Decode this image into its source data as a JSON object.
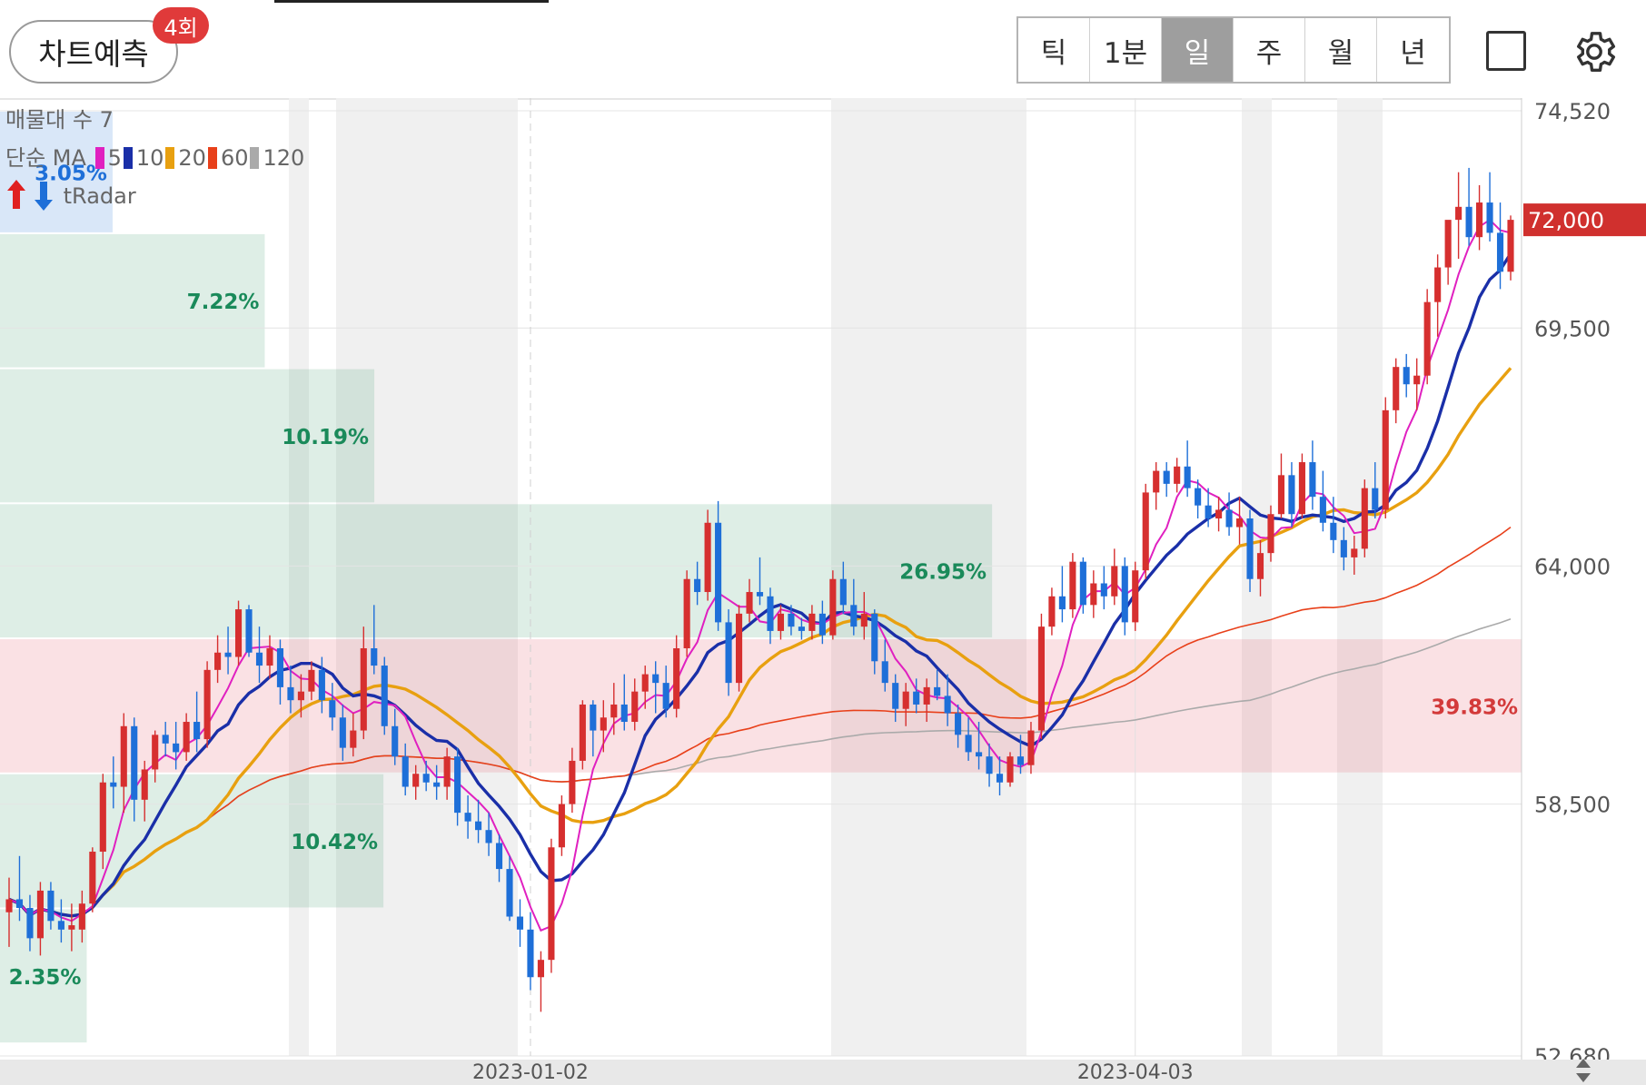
{
  "header": {
    "predict_label": "차트예측",
    "predict_badge": "4회",
    "periods": [
      "틱",
      "1분",
      "일",
      "주",
      "월",
      "년"
    ],
    "active_period": "일"
  },
  "legend": {
    "volume_profile": "매물대 수 7",
    "ma_prefix": "단순 MA",
    "ma": [
      {
        "label": "5",
        "color": "#e020c0"
      },
      {
        "label": "10",
        "color": "#1a2fa8"
      },
      {
        "label": "20",
        "color": "#e8a010"
      },
      {
        "label": "60",
        "color": "#e8401a"
      },
      {
        "label": "120",
        "color": "#aaaaaa"
      }
    ],
    "tradar": "tRadar"
  },
  "chart_data": {
    "type": "candlestick",
    "ylim": [
      52680,
      74520
    ],
    "y_ticks": [
      "74,520",
      "69,500",
      "64,000",
      "58,500",
      "52,680"
    ],
    "y_tick_values": [
      74520,
      69500,
      64000,
      58500,
      52680
    ],
    "current_price": "72,000",
    "current_price_value": 72000,
    "x_ticks": [
      "2023-01-02",
      "2023-04-03"
    ],
    "up_color": "#d62f2f",
    "down_color": "#1e6fd8",
    "volume_profile": [
      {
        "low": 71690,
        "high": 74520,
        "pct": "3.05%",
        "width": 0.074
      },
      {
        "low": 68570,
        "high": 71690,
        "pct": "7.22%",
        "width": 0.174
      },
      {
        "low": 65450,
        "high": 68570,
        "pct": "10.19%",
        "width": 0.246
      },
      {
        "low": 62330,
        "high": 65450,
        "pct": "26.95%",
        "width": 0.652
      },
      {
        "low": 59210,
        "high": 62330,
        "pct": "39.83%",
        "width": 1.0
      },
      {
        "low": 56090,
        "high": 59210,
        "pct": "10.42%",
        "width": 0.252
      },
      {
        "low": 52970,
        "high": 56090,
        "pct": "2.35%",
        "width": 0.057
      }
    ],
    "candles": [
      [
        56000,
        56800,
        55200,
        56300
      ],
      [
        56300,
        57300,
        55800,
        56100
      ],
      [
        56100,
        56400,
        55100,
        55400
      ],
      [
        55400,
        56700,
        55000,
        56500
      ],
      [
        56500,
        56700,
        55600,
        55800
      ],
      [
        55800,
        56300,
        55300,
        55600
      ],
      [
        55600,
        56200,
        55100,
        55700
      ],
      [
        55600,
        56500,
        55300,
        56200
      ],
      [
        56200,
        57500,
        56000,
        57400
      ],
      [
        57400,
        59200,
        57000,
        59000
      ],
      [
        59000,
        59600,
        58400,
        58900
      ],
      [
        58900,
        60600,
        58300,
        60300
      ],
      [
        60300,
        60500,
        58100,
        58600
      ],
      [
        58600,
        59500,
        58100,
        59300
      ],
      [
        59300,
        60200,
        59000,
        60100
      ],
      [
        60100,
        60400,
        59600,
        59900
      ],
      [
        59900,
        60400,
        59300,
        59700
      ],
      [
        59700,
        60600,
        59500,
        60400
      ],
      [
        60400,
        61100,
        59700,
        60000
      ],
      [
        60000,
        61800,
        59800,
        61600
      ],
      [
        61600,
        62400,
        61300,
        62000
      ],
      [
        62000,
        62600,
        61500,
        61900
      ],
      [
        61900,
        63200,
        61700,
        63000
      ],
      [
        63000,
        63100,
        61900,
        62000
      ],
      [
        62000,
        62600,
        61300,
        61700
      ],
      [
        61700,
        62400,
        61400,
        62100
      ],
      [
        62100,
        62300,
        60800,
        61200
      ],
      [
        61200,
        61700,
        60600,
        60900
      ],
      [
        60900,
        61500,
        60500,
        61100
      ],
      [
        61100,
        61800,
        60900,
        61600
      ],
      [
        61600,
        61900,
        60600,
        60900
      ],
      [
        60900,
        61300,
        60200,
        60500
      ],
      [
        60500,
        60800,
        59500,
        59800
      ],
      [
        59800,
        60600,
        59600,
        60200
      ],
      [
        60200,
        62600,
        60000,
        62100
      ],
      [
        62100,
        63100,
        61500,
        61700
      ],
      [
        61700,
        61900,
        60100,
        60300
      ],
      [
        60300,
        60700,
        59400,
        59600
      ],
      [
        59600,
        59900,
        58700,
        58900
      ],
      [
        58900,
        59400,
        58600,
        59200
      ],
      [
        59200,
        59500,
        58800,
        59000
      ],
      [
        59000,
        59400,
        58600,
        58900
      ],
      [
        58900,
        59800,
        58600,
        59600
      ],
      [
        59600,
        59800,
        58000,
        58300
      ],
      [
        58300,
        58700,
        57700,
        58100
      ],
      [
        58100,
        58600,
        57600,
        57900
      ],
      [
        57900,
        58300,
        57300,
        57600
      ],
      [
        57600,
        57800,
        56700,
        57000
      ],
      [
        57000,
        57300,
        55800,
        55900
      ],
      [
        55900,
        56300,
        55200,
        55600
      ],
      [
        55600,
        56000,
        54200,
        54500
      ],
      [
        54500,
        55100,
        53700,
        54900
      ],
      [
        54900,
        57700,
        54600,
        57500
      ],
      [
        57500,
        58700,
        57300,
        58500
      ],
      [
        58500,
        59800,
        58300,
        59500
      ],
      [
        59500,
        60900,
        59300,
        60800
      ],
      [
        60800,
        60900,
        59600,
        60200
      ],
      [
        60200,
        60900,
        59700,
        60500
      ],
      [
        60500,
        61300,
        60100,
        60800
      ],
      [
        60800,
        61500,
        60200,
        60400
      ],
      [
        60400,
        61400,
        60200,
        61100
      ],
      [
        61100,
        61700,
        60700,
        61500
      ],
      [
        61500,
        61800,
        60600,
        61300
      ],
      [
        61300,
        61700,
        60500,
        60700
      ],
      [
        60700,
        62400,
        60500,
        62100
      ],
      [
        62100,
        63900,
        61900,
        63700
      ],
      [
        63700,
        64100,
        63100,
        63400
      ],
      [
        63400,
        65300,
        63200,
        65000
      ],
      [
        65000,
        65500,
        62500,
        62700
      ],
      [
        62700,
        63000,
        61000,
        61300
      ],
      [
        61300,
        63100,
        61100,
        62900
      ],
      [
        62900,
        63700,
        62700,
        63400
      ],
      [
        63400,
        64200,
        63100,
        63300
      ],
      [
        63300,
        63500,
        62200,
        62500
      ],
      [
        62500,
        63100,
        62300,
        62900
      ],
      [
        62900,
        63100,
        62400,
        62600
      ],
      [
        62600,
        62800,
        62300,
        62500
      ],
      [
        62500,
        63100,
        62300,
        62900
      ],
      [
        62900,
        63200,
        62200,
        62400
      ],
      [
        62400,
        63900,
        62300,
        63700
      ],
      [
        63700,
        64100,
        62900,
        63100
      ],
      [
        63100,
        63700,
        62400,
        62600
      ],
      [
        62600,
        63400,
        62300,
        62900
      ],
      [
        62900,
        63000,
        61500,
        61800
      ],
      [
        61800,
        62300,
        61100,
        61300
      ],
      [
        61300,
        61500,
        60400,
        60700
      ],
      [
        60700,
        61300,
        60300,
        61100
      ],
      [
        61100,
        61400,
        60600,
        60800
      ],
      [
        60800,
        61400,
        60400,
        61200
      ],
      [
        61200,
        61600,
        60900,
        61000
      ],
      [
        61000,
        61500,
        60300,
        60600
      ],
      [
        60600,
        60800,
        59800,
        60100
      ],
      [
        60100,
        60500,
        59500,
        59700
      ],
      [
        59700,
        60400,
        59300,
        59600
      ],
      [
        59600,
        59900,
        58900,
        59200
      ],
      [
        59200,
        59600,
        58700,
        59000
      ],
      [
        59000,
        59700,
        58900,
        59600
      ],
      [
        59600,
        60100,
        59200,
        59400
      ],
      [
        59400,
        60400,
        59200,
        60200
      ],
      [
        60200,
        62900,
        60000,
        62600
      ],
      [
        62600,
        63500,
        62400,
        63300
      ],
      [
        63300,
        64000,
        62700,
        63000
      ],
      [
        63000,
        64300,
        62800,
        64100
      ],
      [
        64100,
        64200,
        62900,
        63100
      ],
      [
        63100,
        63900,
        62800,
        63600
      ],
      [
        63600,
        64000,
        63000,
        63300
      ],
      [
        63300,
        64400,
        63100,
        64000
      ],
      [
        64000,
        64200,
        62400,
        62700
      ],
      [
        62700,
        64100,
        62500,
        63900
      ],
      [
        63900,
        65900,
        63700,
        65700
      ],
      [
        65700,
        66400,
        65300,
        66200
      ],
      [
        66200,
        66400,
        65600,
        65900
      ],
      [
        65900,
        66500,
        65700,
        66300
      ],
      [
        66300,
        66900,
        65600,
        65800
      ],
      [
        65800,
        66000,
        65100,
        65400
      ],
      [
        65400,
        65800,
        64900,
        65100
      ],
      [
        65100,
        65600,
        64800,
        65300
      ],
      [
        65300,
        65700,
        64700,
        64900
      ],
      [
        64900,
        65600,
        64500,
        65100
      ],
      [
        65100,
        65300,
        63400,
        63700
      ],
      [
        63700,
        64600,
        63300,
        64300
      ],
      [
        64300,
        65400,
        64100,
        65200
      ],
      [
        65200,
        66600,
        65100,
        66100
      ],
      [
        66100,
        66400,
        64900,
        65200
      ],
      [
        65200,
        66600,
        65100,
        66400
      ],
      [
        66400,
        66900,
        65300,
        65600
      ],
      [
        65600,
        66200,
        64800,
        65000
      ],
      [
        65000,
        65600,
        64300,
        64600
      ],
      [
        64600,
        64900,
        63900,
        64200
      ],
      [
        64200,
        64700,
        63800,
        64400
      ],
      [
        64400,
        66000,
        64200,
        65800
      ],
      [
        65800,
        66400,
        65100,
        65300
      ],
      [
        65300,
        67900,
        65100,
        67600
      ],
      [
        67600,
        68800,
        67300,
        68600
      ],
      [
        68600,
        68900,
        67900,
        68200
      ],
      [
        68200,
        68800,
        67600,
        68400
      ],
      [
        68400,
        70400,
        68200,
        70100
      ],
      [
        70100,
        71200,
        69300,
        70900
      ],
      [
        70900,
        71800,
        70500,
        72000
      ],
      [
        72000,
        73100,
        71100,
        72300
      ],
      [
        72300,
        73200,
        71400,
        71600
      ],
      [
        71600,
        72800,
        71300,
        72400
      ],
      [
        72400,
        73100,
        71500,
        71700
      ],
      [
        71700,
        72400,
        70400,
        70800
      ],
      [
        70800,
        72100,
        70600,
        72000
      ]
    ]
  }
}
